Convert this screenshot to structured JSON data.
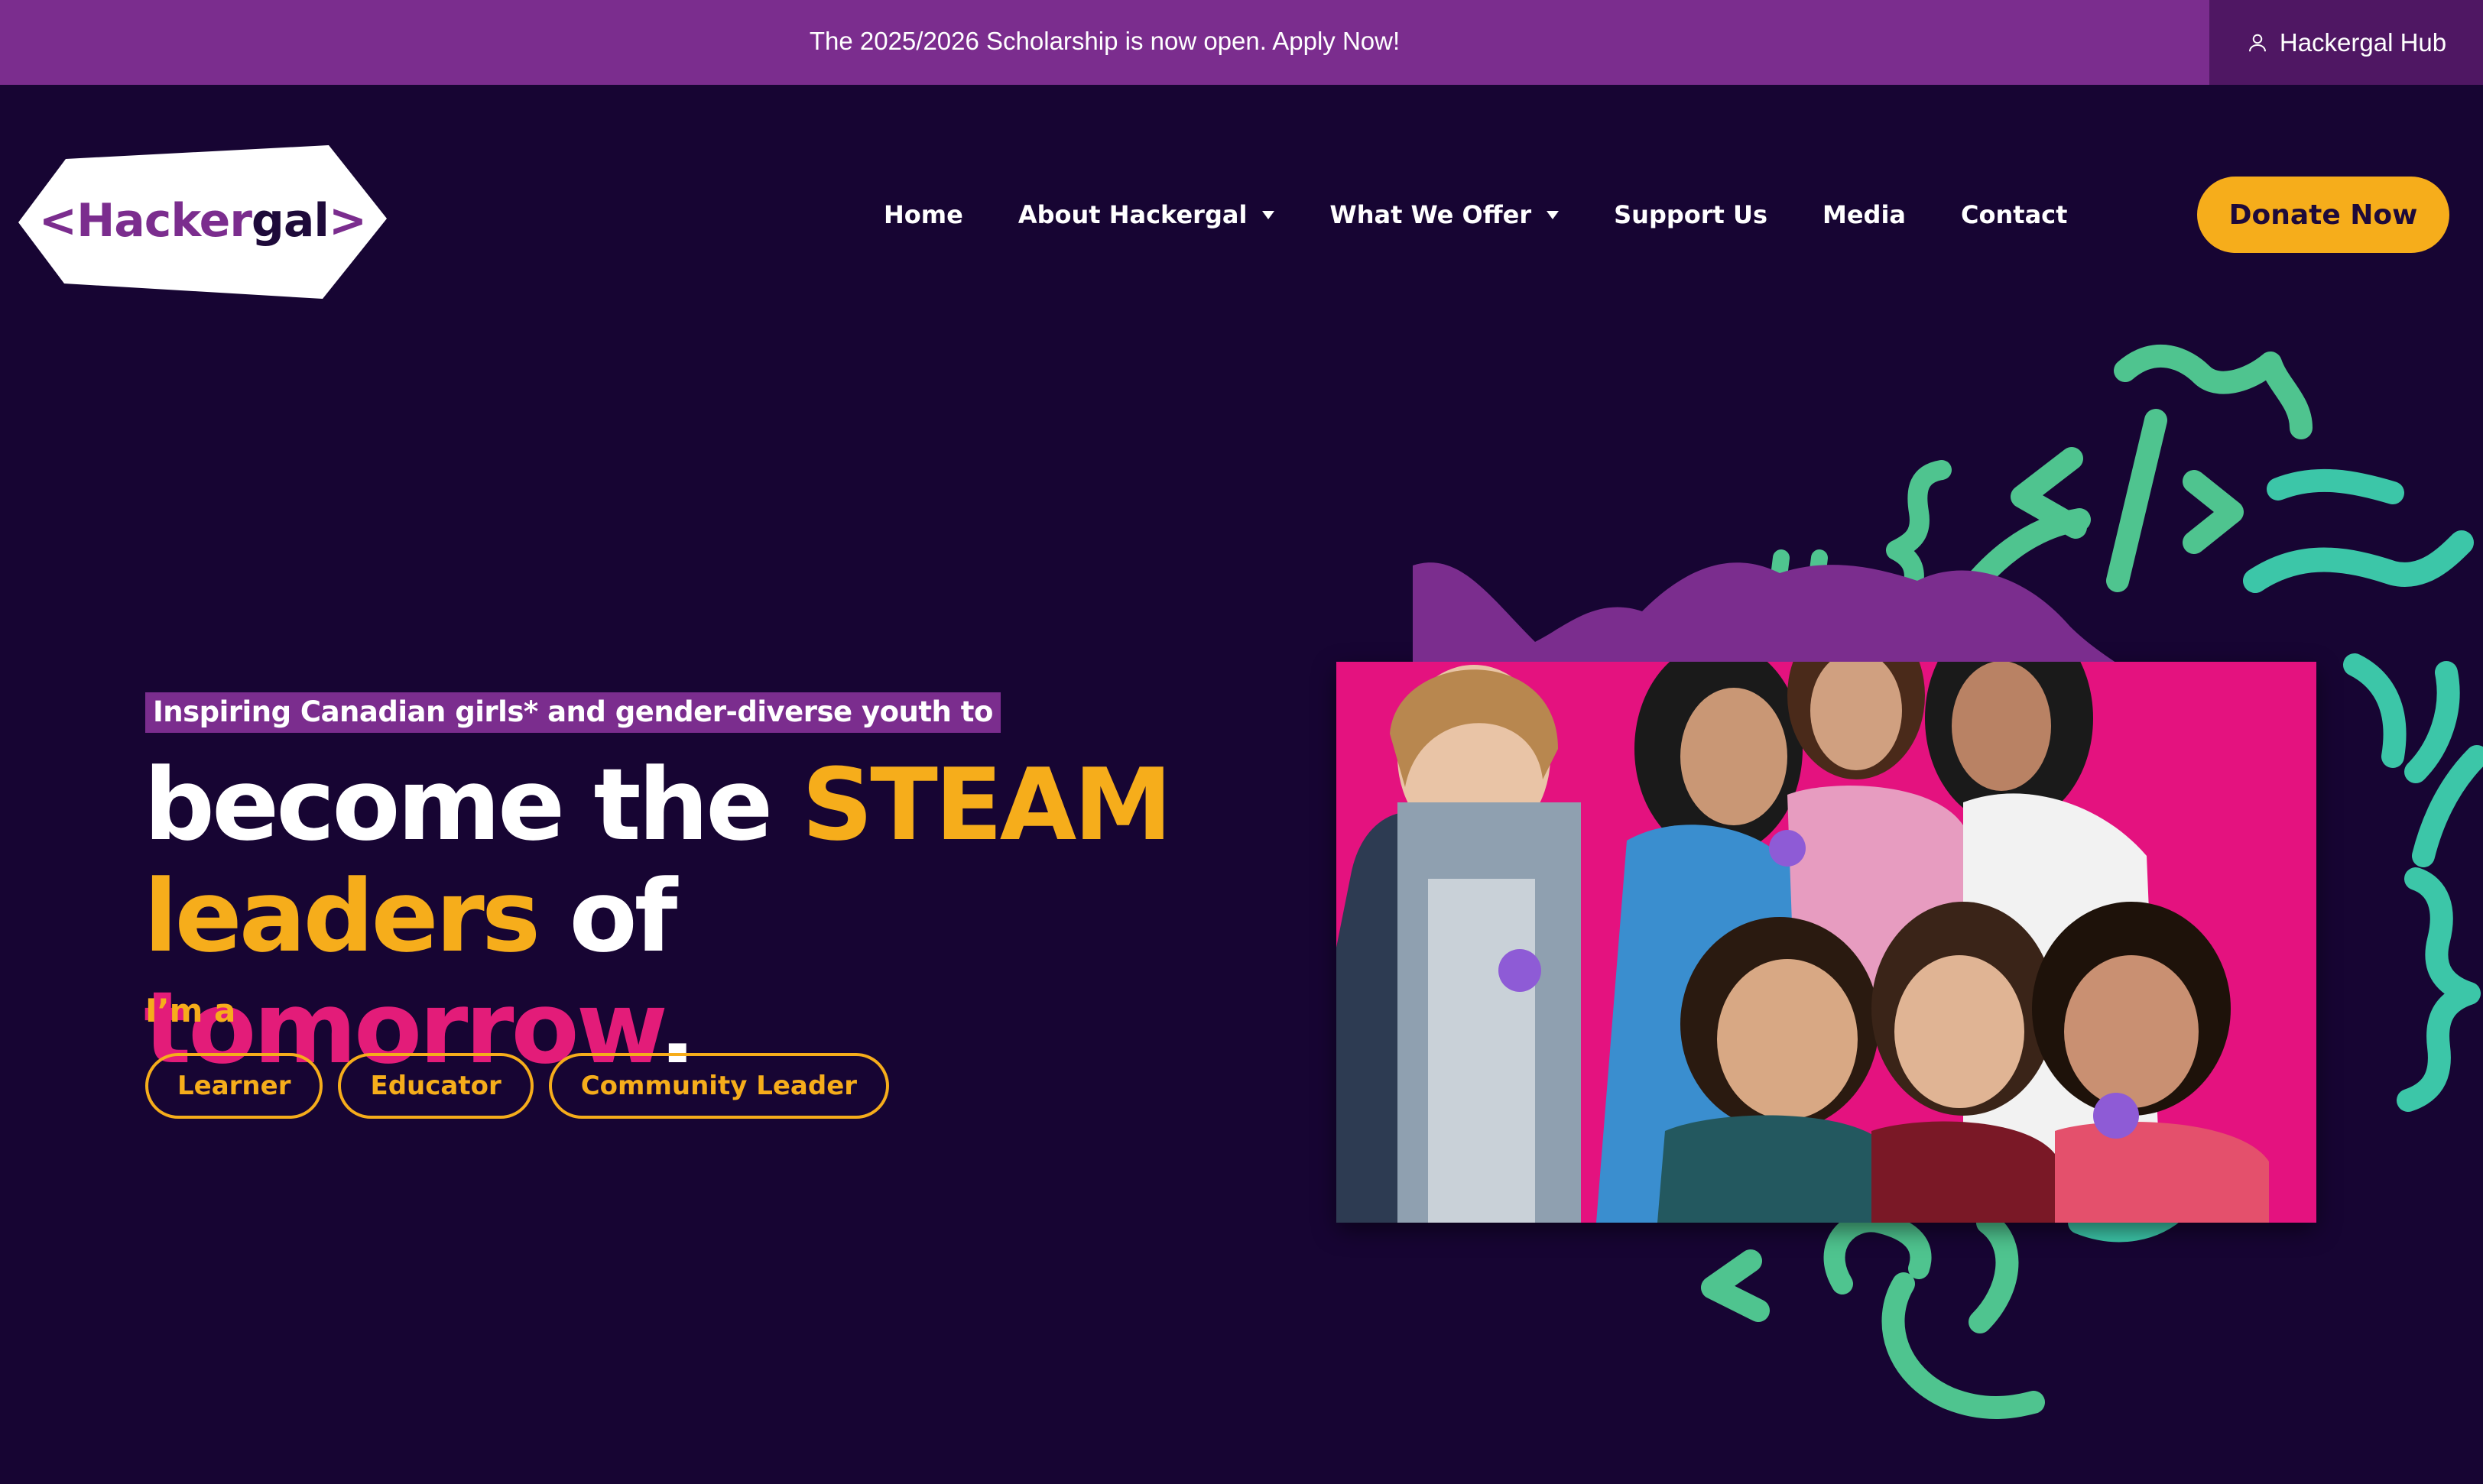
{
  "announcement": {
    "message": "The 2025/2026 Scholarship is now open. Apply Now!",
    "hub_label": "Hackergal Hub",
    "hub_icon": "user-icon"
  },
  "header": {
    "logo": {
      "bracket_left": "<",
      "name_part1": "Hacker",
      "name_part2": "gal",
      "bracket_right": ">"
    },
    "nav": [
      {
        "label": "Home",
        "has_dropdown": false
      },
      {
        "label": "About Hackergal",
        "has_dropdown": true
      },
      {
        "label": "What We Offer",
        "has_dropdown": true
      },
      {
        "label": "Support Us",
        "has_dropdown": false
      },
      {
        "label": "Media",
        "has_dropdown": false
      },
      {
        "label": "Contact",
        "has_dropdown": false
      }
    ],
    "donate_label": "Donate Now"
  },
  "hero": {
    "tagline": "Inspiring Canadian girls* and gender-diverse youth to",
    "headline": {
      "w1": "become the ",
      "w2": "STEAM",
      "w3": "leaders",
      "w4": " of ",
      "w5": "tomorrow",
      "w6": "."
    },
    "role_prompt": "I’m a",
    "roles": [
      "Learner",
      "Educator",
      "Community Leader"
    ]
  },
  "colors": {
    "background": "#170533",
    "announcement_bar": "#7b2d8e",
    "hub_bg": "#4f1763",
    "gold": "#f6ad1b",
    "pink": "#e31c79",
    "green": "#58c48c",
    "teal": "#3cc6a8"
  }
}
